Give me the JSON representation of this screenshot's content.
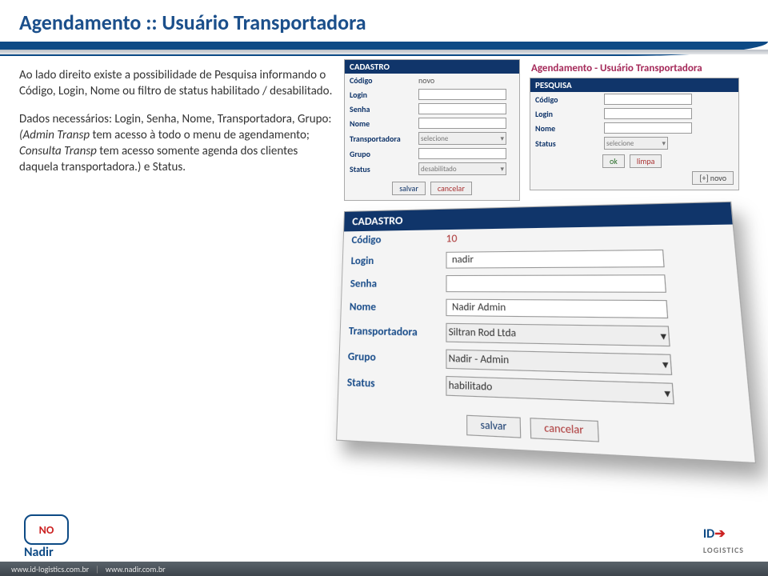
{
  "title": "Agendamento :: Usuário Transportadora",
  "body": {
    "p1": "Ao lado direito existe a possibilidade de Pesquisa informando o Código, Login, Nome ou filtro de status habilitado / desabilitado.",
    "p2a": "Dados necessários: Login, Senha, Nome, Transportadora, Grupo:",
    "p2b": "(Admin Transp tem acesso à todo o menu de agendamento; Consulta Transp tem acesso somente agenda dos clientes daquela transportadora.) e Status.",
    "p2b_em_prefix": "(Admin Transp",
    "p2b_mid1": " tem acesso à todo o menu de agendamento; ",
    "p2b_em2": "Consulta Transp",
    "p2b_mid2": " tem acesso somente agenda dos clientes daquela transportadora.)",
    "p2b_tail": " e Status."
  },
  "pesquisa": {
    "breadcrumb": "Agendamento - Usuário Transportadora",
    "header": "PESQUISA",
    "labels": {
      "codigo": "Código",
      "login": "Login",
      "nome": "Nome",
      "status": "Status"
    },
    "status_placeholder": "selecione",
    "ok": "ok",
    "limpa": "limpa",
    "novo": "[+] novo"
  },
  "cad1": {
    "header": "CADASTRO",
    "labels": {
      "codigo": "Código",
      "login": "Login",
      "senha": "Senha",
      "nome": "Nome",
      "transportadora": "Transportadora",
      "grupo": "Grupo",
      "status": "Status"
    },
    "codigo_value": "novo",
    "transp_placeholder": "selecione",
    "status_value": "desabilitado",
    "salvar": "salvar",
    "cancelar": "cancelar"
  },
  "cad2": {
    "header": "CADASTRO",
    "labels": {
      "codigo": "Código",
      "login": "Login",
      "senha": "Senha",
      "nome": "Nome",
      "transportadora": "Transportadora",
      "grupo": "Grupo",
      "status": "Status"
    },
    "codigo_value": "10",
    "login_value": "nadir",
    "nome_value": "Nadir Admin",
    "transportadora_value": "Siltran Rod Ltda",
    "grupo_value": "Nadir - Admin",
    "status_value": "habilitado",
    "salvar": "salvar",
    "cancelar": "cancelar"
  },
  "footer": {
    "logo_text": "NO",
    "nadir": "Nadir",
    "idlogistics": "LOGISTICS",
    "url1": "www.id-logistics.com.br",
    "url2": "www.nadir.com.br"
  }
}
